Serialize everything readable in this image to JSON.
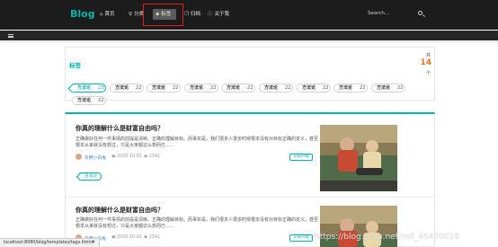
{
  "nav": {
    "brand": "Blog",
    "items": [
      {
        "label": "首页",
        "icon": "home-icon"
      },
      {
        "label": "分类",
        "icon": "idea-icon"
      },
      {
        "label": "标签",
        "icon": "tags-icon"
      },
      {
        "label": "归档",
        "icon": "clone-icon"
      },
      {
        "label": "关于我",
        "icon": "info-icon"
      }
    ],
    "active": "标签",
    "search_placeholder": "Search...",
    "highlight_color": "#e0201a"
  },
  "tags_header": {
    "title": "标签",
    "count_prefix": "共",
    "count": "14",
    "count_suffix": "个"
  },
  "tags": [
    {
      "name": "方法论",
      "count": "23",
      "active": true
    },
    {
      "name": "方法论",
      "count": "22"
    },
    {
      "name": "方法论",
      "count": "22"
    },
    {
      "name": "方法论",
      "count": "22"
    },
    {
      "name": "方法论",
      "count": "22"
    },
    {
      "name": "方法论",
      "count": "22"
    },
    {
      "name": "方法论",
      "count": "22"
    },
    {
      "name": "方法论",
      "count": "22"
    },
    {
      "name": "方法论",
      "count": "22"
    },
    {
      "name": "方法论",
      "count": "22"
    }
  ],
  "posts": [
    {
      "title": "你真的理解什么是财富自由吗？",
      "excerpt": "正确做好任何一件事情的前提是清晰、正确的理解目标。而事实是，我们很多人很多时候根本没有对目标正确的定义，甚至根本从来就没有想过，只是大家都这么想而已……",
      "author": "东野小白兔",
      "date": "2020-10-01",
      "views": "2342",
      "category": "认知升级",
      "tag": "方法论"
    },
    {
      "title": "你真的理解什么是财富自由吗？",
      "excerpt": "正确做好任何一件事情的前提是清晰、正确的理解目标。而事实是，我们很多人很多时候根本没有对目标正确的定义，甚至根本从来就没有想过，只是大家都这么想而已……",
      "author": "东野小白兔",
      "date": "2020-10-01",
      "views": "2342",
      "category": "认知升级"
    }
  ],
  "status_url": "localhost:8080/blog/templates/tags.html#",
  "watermark": "https://blog.csdn.net/m0_46470018",
  "colors": {
    "accent": "#00b5ad",
    "count": "#f2711c",
    "nav_bg": "#1c1c1c"
  }
}
